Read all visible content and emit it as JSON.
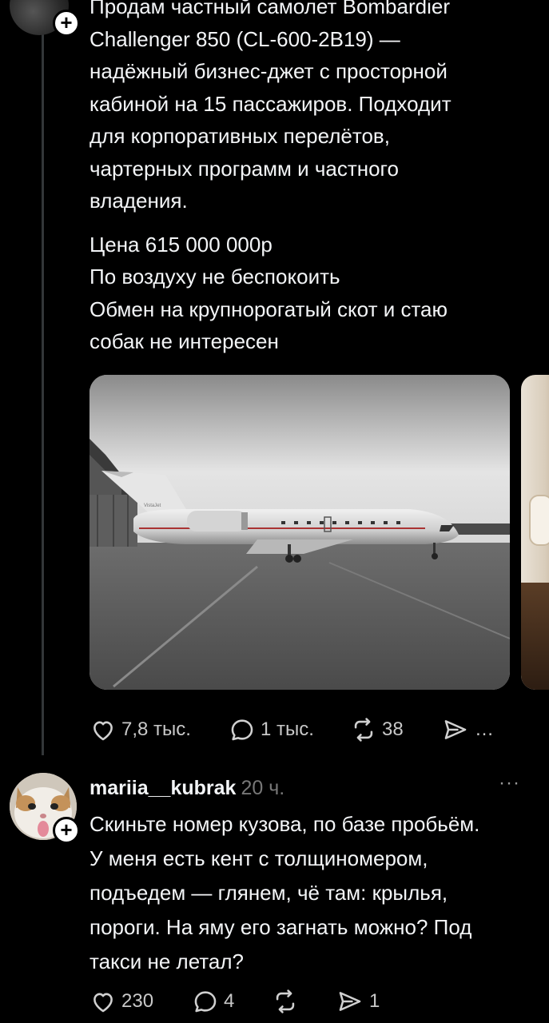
{
  "post": {
    "lines": [
      "Продам частный самолет Bombardier",
      "Challenger 850 (CL-600-2B19) —",
      "надёжный бизнес-джет с просторной",
      "кабиной на 15 пассажиров. Подходит",
      "для корпоративных перелётов,",
      "чартерных программ и частного",
      "владения."
    ],
    "lines2": [
      "Цена 615 000 000р",
      "По воздуху не беспокоить",
      "Обмен на крупнорогатый скот и стаю",
      "собак не интересен"
    ],
    "image_caption_tail": "VistaJet",
    "actions": {
      "likes": "7,8 тыс.",
      "replies": "1 тыс.",
      "reposts": "38",
      "share_more": "…"
    }
  },
  "comment": {
    "username": "mariia__kubrak",
    "time": "20 ч.",
    "more": "···",
    "lines": [
      "Скиньте номер кузова, по базе пробьём.",
      "У меня есть кент с толщиномером,",
      "подъедем — глянем, чё там: крылья,",
      "пороги. На яму его загнать можно? Под",
      "такси не летал?"
    ],
    "actions": {
      "likes": "230",
      "replies": "4",
      "reposts": "",
      "shares": "1"
    }
  },
  "colors": {
    "background": "#000000",
    "text": "#f3f5f7",
    "muted": "#777777",
    "thread_line": "#333638"
  }
}
